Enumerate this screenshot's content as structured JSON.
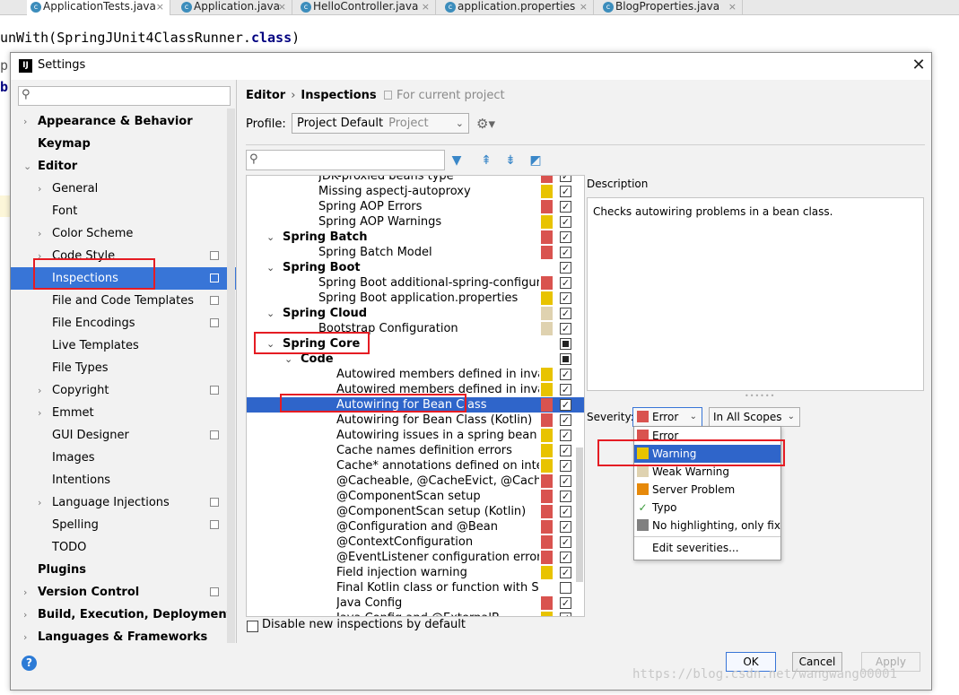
{
  "editor": {
    "tabs": [
      {
        "label": "ApplicationTests.java",
        "active": true
      },
      {
        "label": "Application.java",
        "active": false
      },
      {
        "label": "HelloController.java",
        "active": false
      },
      {
        "label": "application.properties",
        "active": false
      },
      {
        "label": "BlogProperties.java",
        "active": false
      }
    ],
    "code_line_1_prefix": "unWith(SpringJUnit4ClassRunner.",
    "code_line_1_keyword": "class",
    "code_line_1_suffix": ")",
    "code_line_2": "pr",
    "code_line_3": "b"
  },
  "dialog": {
    "title": "Settings",
    "close_icon": "close-icon"
  },
  "sidebar": {
    "search_placeholder": "",
    "items": [
      {
        "label": "Appearance & Behavior",
        "bold": true,
        "expandable": true,
        "expanded": false,
        "indent": 0,
        "copy": false
      },
      {
        "label": "Keymap",
        "bold": true,
        "expandable": false,
        "indent": 0,
        "copy": false
      },
      {
        "label": "Editor",
        "bold": true,
        "expandable": true,
        "expanded": true,
        "indent": 0,
        "copy": false
      },
      {
        "label": "General",
        "bold": false,
        "expandable": true,
        "expanded": false,
        "indent": 1,
        "copy": false
      },
      {
        "label": "Font",
        "bold": false,
        "expandable": false,
        "indent": 1,
        "copy": false
      },
      {
        "label": "Color Scheme",
        "bold": false,
        "expandable": true,
        "expanded": false,
        "indent": 1,
        "copy": false
      },
      {
        "label": "Code Style",
        "bold": false,
        "expandable": true,
        "expanded": false,
        "indent": 1,
        "copy": true
      },
      {
        "label": "Inspections",
        "bold": false,
        "expandable": false,
        "indent": 1,
        "copy": true,
        "selected": true
      },
      {
        "label": "File and Code Templates",
        "bold": false,
        "expandable": false,
        "indent": 1,
        "copy": true
      },
      {
        "label": "File Encodings",
        "bold": false,
        "expandable": false,
        "indent": 1,
        "copy": true
      },
      {
        "label": "Live Templates",
        "bold": false,
        "expandable": false,
        "indent": 1,
        "copy": false
      },
      {
        "label": "File Types",
        "bold": false,
        "expandable": false,
        "indent": 1,
        "copy": false
      },
      {
        "label": "Copyright",
        "bold": false,
        "expandable": true,
        "expanded": false,
        "indent": 1,
        "copy": true
      },
      {
        "label": "Emmet",
        "bold": false,
        "expandable": true,
        "expanded": false,
        "indent": 1,
        "copy": false
      },
      {
        "label": "GUI Designer",
        "bold": false,
        "expandable": false,
        "indent": 1,
        "copy": true
      },
      {
        "label": "Images",
        "bold": false,
        "expandable": false,
        "indent": 1,
        "copy": false
      },
      {
        "label": "Intentions",
        "bold": false,
        "expandable": false,
        "indent": 1,
        "copy": false
      },
      {
        "label": "Language Injections",
        "bold": false,
        "expandable": true,
        "expanded": false,
        "indent": 1,
        "copy": true
      },
      {
        "label": "Spelling",
        "bold": false,
        "expandable": false,
        "indent": 1,
        "copy": true
      },
      {
        "label": "TODO",
        "bold": false,
        "expandable": false,
        "indent": 1,
        "copy": false
      },
      {
        "label": "Plugins",
        "bold": true,
        "expandable": false,
        "indent": 0,
        "copy": false
      },
      {
        "label": "Version Control",
        "bold": true,
        "expandable": true,
        "expanded": false,
        "indent": 0,
        "copy": true
      },
      {
        "label": "Build, Execution, Deployment",
        "bold": true,
        "expandable": true,
        "expanded": false,
        "indent": 0,
        "copy": false
      },
      {
        "label": "Languages & Frameworks",
        "bold": true,
        "expandable": true,
        "expanded": false,
        "indent": 0,
        "copy": false
      }
    ]
  },
  "header": {
    "breadcrumb_1": "Editor",
    "breadcrumb_sep": "›",
    "breadcrumb_2": "Inspections",
    "scope_note": "For current project",
    "profile_label": "Profile:",
    "profile_value": "Project Default",
    "profile_sub": "Project"
  },
  "toolbar": {
    "icons": [
      "filter-icon",
      "expand-all-icon",
      "collapse-all-icon",
      "reset-icon"
    ]
  },
  "severity_colors": {
    "error": "#d9534f",
    "warning": "#e8c300",
    "weak": "#dfd2b0",
    "server": "#e6890a",
    "none": "#808080"
  },
  "inspections": [
    {
      "label": "JDK-proxied beans type",
      "indent": 3,
      "sev": "error",
      "check": "checked",
      "partial_top": true
    },
    {
      "label": "Missing aspectj-autoproxy",
      "indent": 3,
      "sev": "warning",
      "check": "checked"
    },
    {
      "label": "Spring AOP Errors",
      "indent": 3,
      "sev": "error",
      "check": "checked"
    },
    {
      "label": "Spring AOP Warnings",
      "indent": 3,
      "sev": "warning",
      "check": "checked"
    },
    {
      "label": "Spring Batch",
      "indent": 1,
      "group": true,
      "sev": "error",
      "check": "checked"
    },
    {
      "label": "Spring Batch Model",
      "indent": 3,
      "sev": "error",
      "check": "checked"
    },
    {
      "label": "Spring Boot",
      "indent": 1,
      "group": true,
      "sev": "",
      "check": "checked"
    },
    {
      "label": "Spring Boot additional-spring-configuration-",
      "indent": 3,
      "sev": "error",
      "check": "checked"
    },
    {
      "label": "Spring Boot application.properties",
      "indent": 3,
      "sev": "warning",
      "check": "checked"
    },
    {
      "label": "Spring Cloud",
      "indent": 1,
      "group": true,
      "sev": "weak",
      "check": "checked"
    },
    {
      "label": "Bootstrap Configuration",
      "indent": 3,
      "sev": "weak",
      "check": "checked"
    },
    {
      "label": "Spring Core",
      "indent": 1,
      "group": true,
      "sev": "",
      "check": "partial"
    },
    {
      "label": "Code",
      "indent": 2,
      "group": true,
      "sev": "",
      "check": "partial"
    },
    {
      "label": "Autowired members defined in invalid Spr",
      "indent": 4,
      "sev": "warning",
      "check": "checked"
    },
    {
      "label": "Autowired members defined in invalid Spr",
      "indent": 4,
      "sev": "warning",
      "check": "checked"
    },
    {
      "label": "Autowiring for Bean Class",
      "indent": 4,
      "sev": "error",
      "check": "checked",
      "selected": true
    },
    {
      "label": "Autowiring for Bean Class (Kotlin)",
      "indent": 4,
      "sev": "error",
      "check": "checked"
    },
    {
      "label": "Autowiring issues in a spring bean class c",
      "indent": 4,
      "sev": "warning",
      "check": "checked"
    },
    {
      "label": "Cache names definition errors",
      "indent": 4,
      "sev": "warning",
      "check": "checked"
    },
    {
      "label": "Cache* annotations defined on interfaces/",
      "indent": 4,
      "sev": "warning",
      "check": "checked"
    },
    {
      "label": "@Cacheable, @CacheEvict, @CachePut, @",
      "indent": 4,
      "sev": "error",
      "check": "checked"
    },
    {
      "label": "@ComponentScan setup",
      "indent": 4,
      "sev": "error",
      "check": "checked"
    },
    {
      "label": "@ComponentScan setup (Kotlin)",
      "indent": 4,
      "sev": "error",
      "check": "checked"
    },
    {
      "label": "@Configuration and @Bean",
      "indent": 4,
      "sev": "error",
      "check": "checked"
    },
    {
      "label": "@ContextConfiguration",
      "indent": 4,
      "sev": "error",
      "check": "checked"
    },
    {
      "label": "@EventListener configuration error",
      "indent": 4,
      "sev": "error",
      "check": "checked"
    },
    {
      "label": "Field injection warning",
      "indent": 4,
      "sev": "warning",
      "check": "checked"
    },
    {
      "label": "Final Kotlin class or function with Spring a",
      "indent": 4,
      "sev": "",
      "check": "unchecked"
    },
    {
      "label": "Java Config",
      "indent": 4,
      "sev": "error",
      "check": "checked"
    },
    {
      "label": "Java Config and @ExternalB...",
      "indent": 4,
      "sev": "warning",
      "check": "checked"
    }
  ],
  "disable_new": {
    "label": "Disable new inspections by default",
    "checked": false
  },
  "description": {
    "label": "Description",
    "text": "Checks autowiring problems in a bean class."
  },
  "severity": {
    "label": "Severity:",
    "value": "Error",
    "scope_value": "In All Scopes",
    "options": [
      {
        "label": "Error",
        "sev": "error",
        "selected": false
      },
      {
        "label": "Warning",
        "sev": "warning",
        "selected": true
      },
      {
        "label": "Weak Warning",
        "sev": "weak",
        "selected": false
      },
      {
        "label": "Server Problem",
        "sev": "server",
        "selected": false
      },
      {
        "label": "Typo",
        "sev": "typo",
        "selected": false
      },
      {
        "label": "No highlighting, only fix",
        "sev": "none",
        "selected": false
      }
    ],
    "edit_label": "Edit severities..."
  },
  "footer": {
    "ok": "OK",
    "cancel": "Cancel",
    "apply": "Apply",
    "help": "?"
  },
  "watermark": "https://blog.csdn.net/wangwang00001"
}
